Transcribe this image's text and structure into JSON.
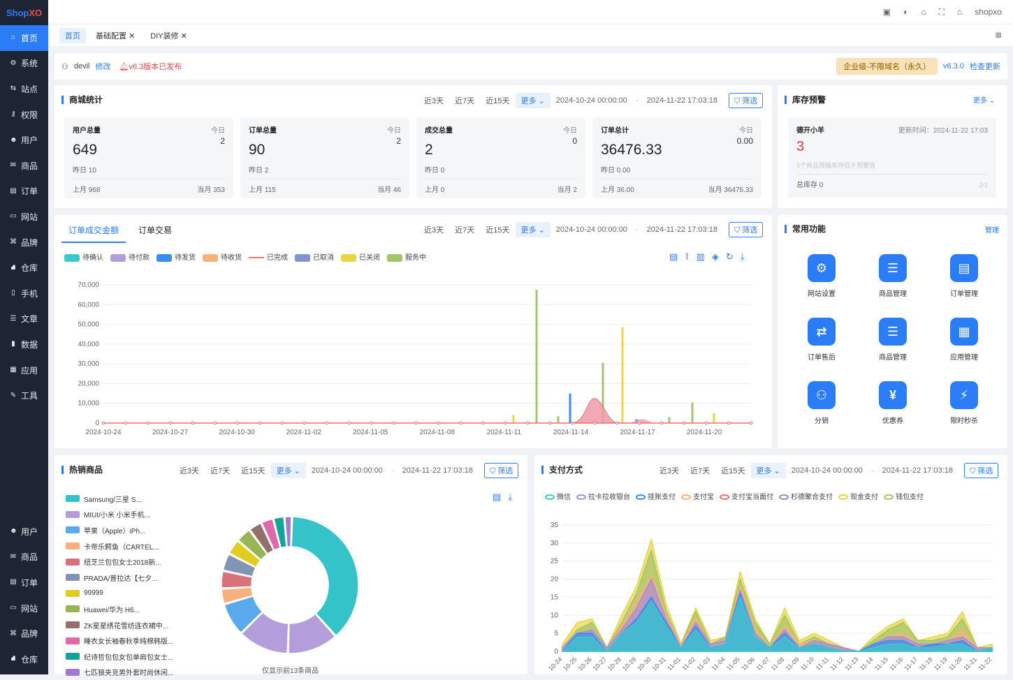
{
  "sidebar": {
    "logo_a": "Shop",
    "logo_b": "XO",
    "items": [
      "首页",
      "系统",
      "站点",
      "权限",
      "用户",
      "商品",
      "订单",
      "网站",
      "品牌",
      "仓库",
      "手机",
      "文章",
      "数据",
      "应用",
      "工具"
    ],
    "bottom": [
      "用户",
      "商品",
      "订单",
      "网站",
      "品牌",
      "仓库"
    ]
  },
  "topbar": {
    "user": "shopxo"
  },
  "tabs": [
    {
      "label": "首页"
    },
    {
      "label": "基础配置 ✕"
    },
    {
      "label": "DIY装修 ✕"
    }
  ],
  "info": {
    "user": "devil",
    "edit": "修改",
    "release": "v6.3版本已发布",
    "edition": "企业级-不限域名（永久）",
    "version": "v6.3.0",
    "check": "检查更新"
  },
  "filter": {
    "d3": "近3天",
    "d7": "近7天",
    "d15": "近15天",
    "more": "更多",
    "start": "2024-10-24 00:00:00",
    "end": "2024-11-22 17:03:18",
    "btn": "筛选"
  },
  "mall": {
    "title": "商城统计",
    "stats": [
      {
        "label": "用户总量",
        "today_label": "今日",
        "today": "2",
        "value": "649",
        "yest": "昨日  10",
        "last": "上月   968",
        "month": "当月   353"
      },
      {
        "label": "订单总量",
        "today_label": "今日",
        "today": "2",
        "value": "90",
        "yest": "昨日 2",
        "last": "上月   115",
        "month": "当月   46"
      },
      {
        "label": "成交总量",
        "today_label": "今日",
        "today": "0",
        "value": "2",
        "yest": "昨日 0",
        "last": "上月   0",
        "month": "当月   2"
      },
      {
        "label": "订单总计",
        "today_label": "今日",
        "today": "0.00",
        "value": "36476.33",
        "yest": "昨日 0.00",
        "last": "上月   36.00",
        "month": "当月   36476.33"
      }
    ]
  },
  "stock": {
    "title": "库存预警",
    "more": "更多",
    "name": "德开小羊",
    "time": "更新时间：2024-11-22 17:03",
    "count": "3",
    "note": "3个商品规格库存低于预警值",
    "total": "总库存   0",
    "page": "2/2"
  },
  "order_chart": {
    "tab1": "订单成交金额",
    "tab2": "订单交易",
    "legend": [
      {
        "name": "待确认",
        "color": "#3cc9c9"
      },
      {
        "name": "待付款",
        "color": "#b39ddb"
      },
      {
        "name": "待发货",
        "color": "#3b8cf0"
      },
      {
        "name": "待收货",
        "color": "#f8b07c"
      },
      {
        "name": "已完成",
        "color": "#ef6e6e"
      },
      {
        "name": "已取消",
        "color": "#7f95d1"
      },
      {
        "name": "已关闭",
        "color": "#e9d543"
      },
      {
        "name": "服务中",
        "color": "#a3c46a"
      }
    ]
  },
  "chart_data": [
    {
      "type": "area",
      "title": "订单成交金额",
      "x": [
        "2024-10-24",
        "2024-10-27",
        "2024-10-30",
        "2024-11-02",
        "2024-11-05",
        "2024-11-08",
        "2024-11-11",
        "2024-11-14",
        "2024-11-17",
        "2024-11-20"
      ],
      "ylim": [
        0,
        70000
      ],
      "yticks": [
        "70,000",
        "60,000",
        "50,000",
        "40,000",
        "30,000",
        "20,000",
        "10,000",
        "0"
      ]
    },
    {
      "type": "pie",
      "title": "热销商品"
    },
    {
      "type": "area",
      "title": "支付方式",
      "x": [
        "10-24",
        "10-25",
        "10-26",
        "10-27",
        "10-28",
        "10-29",
        "10-30",
        "10-31",
        "11-01",
        "11-02",
        "11-03",
        "11-04",
        "11-05",
        "11-06",
        "11-07",
        "11-08",
        "11-09",
        "11-10",
        "11-11",
        "11-12",
        "11-13",
        "11-14",
        "11-15",
        "11-16",
        "11-17",
        "11-18",
        "11-19",
        "11-20",
        "11-21",
        "11-22"
      ],
      "ylim": [
        0,
        35
      ],
      "yticks": [
        "35",
        "30",
        "25",
        "20",
        "15",
        "10",
        "5",
        "0"
      ]
    }
  ],
  "funcs": {
    "title": "常用功能",
    "manage": "管理",
    "items": [
      "网站设置",
      "商品管理",
      "订单管理",
      "订单售后",
      "商品管理",
      "应用管理",
      "分销",
      "优惠券",
      "限时秒杀"
    ]
  },
  "hot": {
    "title": "热销商品",
    "note": "仅显示前13条商品",
    "items": [
      {
        "name": "Samsung/三星 S...",
        "color": "#33c3c9"
      },
      {
        "name": "MIUI/小米 小米手机...",
        "color": "#b39ddb"
      },
      {
        "name": "苹果（Apple）iPh...",
        "color": "#5aa9ec"
      },
      {
        "name": "卡帝乐鳄鱼（CARTEL...",
        "color": "#f8b07c"
      },
      {
        "name": "纽芝兰包包女士2018新...",
        "color": "#d9707a"
      },
      {
        "name": "PRADA/普拉达【七夕...",
        "color": "#8395b4"
      },
      {
        "name": "99999",
        "color": "#e3cc20"
      },
      {
        "name": "Huawei/华为 H6...",
        "color": "#97b552"
      },
      {
        "name": "ZK星星绣花雪纺连衣裙中...",
        "color": "#956e6e"
      },
      {
        "name": "睡衣女长袖春秋季纯棉韩版...",
        "color": "#e06aa9"
      },
      {
        "name": "纪诗哲包包女包单肩包女士...",
        "color": "#12a49a"
      },
      {
        "name": "七匹狼夹克男外套时尚休闲...",
        "color": "#a07ad1"
      }
    ]
  },
  "pay": {
    "title": "支付方式",
    "legend": [
      {
        "name": "微信",
        "color": "#3cc9c9"
      },
      {
        "name": "拉卡拉收银台",
        "color": "#a98ddb"
      },
      {
        "name": "挂账支付",
        "color": "#3b8cf0"
      },
      {
        "name": "支付宝",
        "color": "#f8b07c"
      },
      {
        "name": "支付宝当面付",
        "color": "#ef6e6e"
      },
      {
        "name": "杉德聚合支付",
        "color": "#7f95d1"
      },
      {
        "name": "现金支付",
        "color": "#e9d543"
      },
      {
        "name": "钱包支付",
        "color": "#a3c46a"
      }
    ]
  }
}
